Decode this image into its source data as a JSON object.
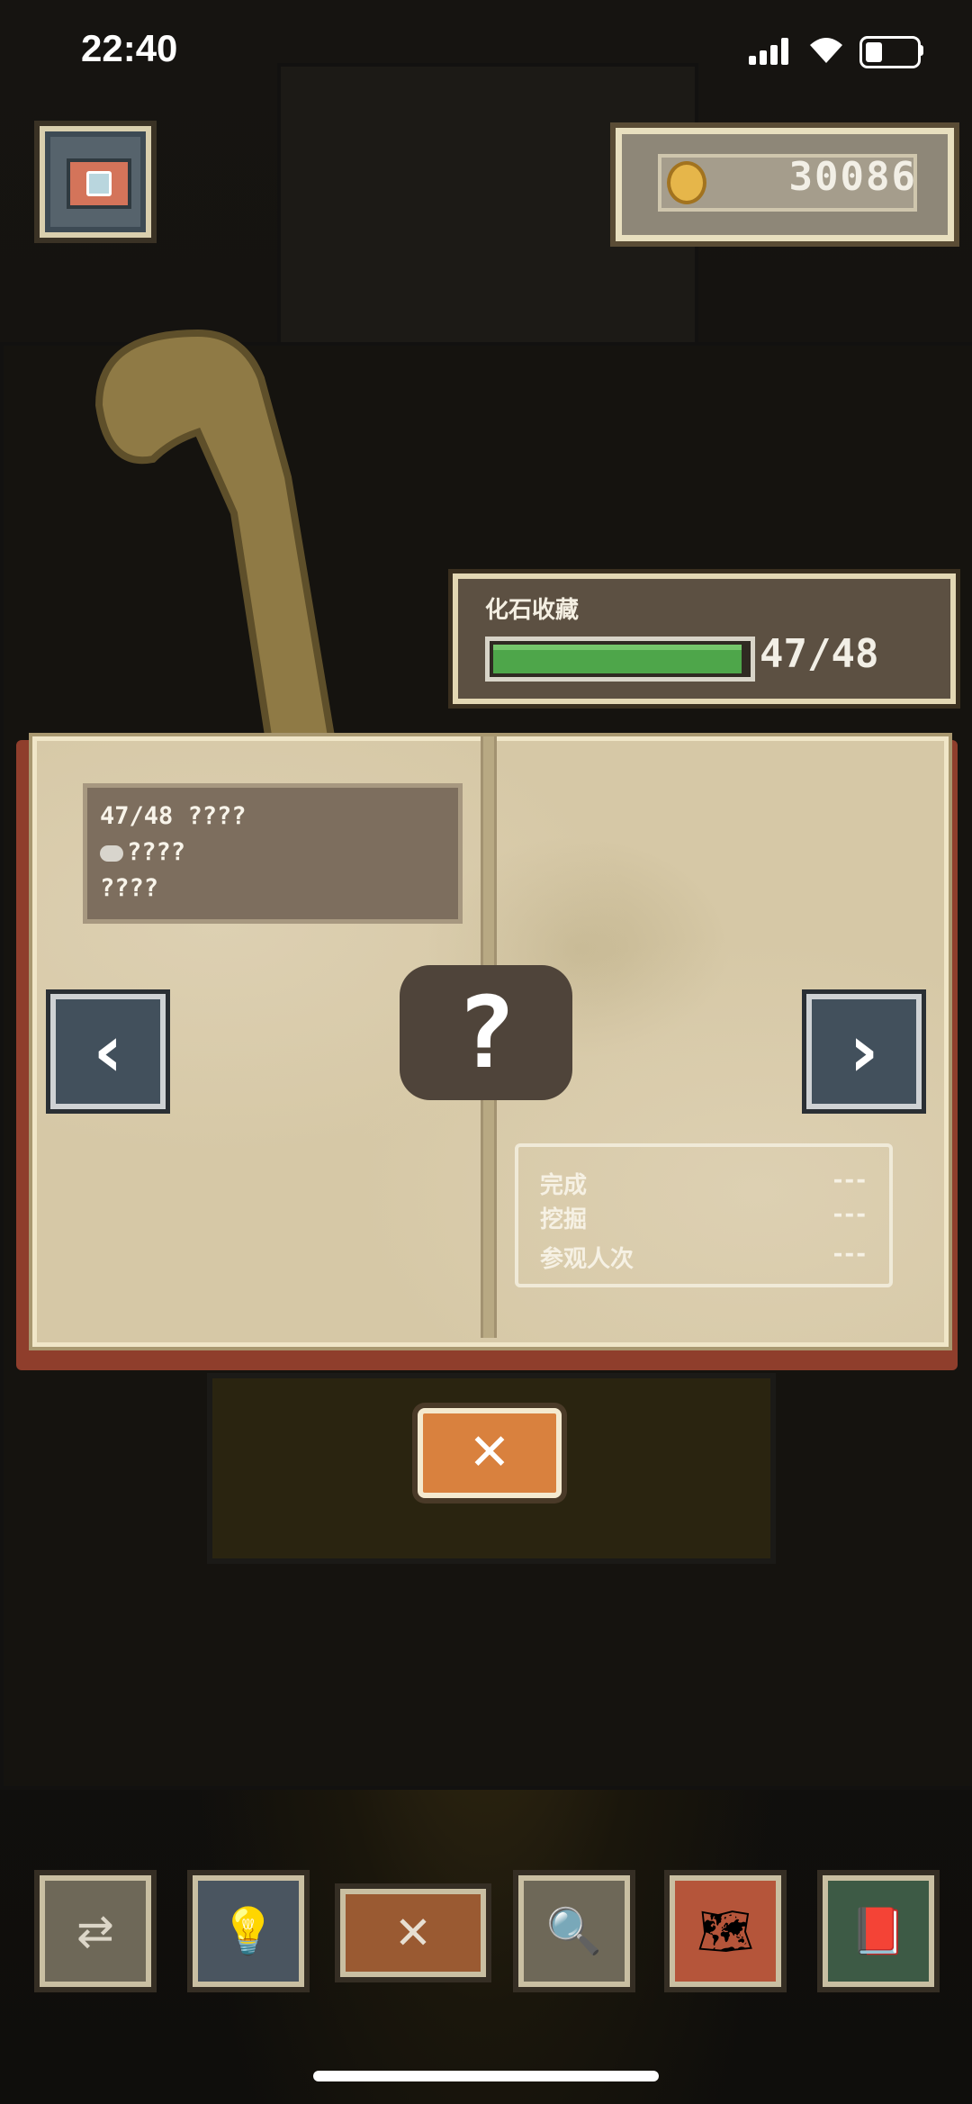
{
  "status_bar": {
    "time": "22:40"
  },
  "top": {
    "coin_amount": "30086",
    "camera_icon": "camera-icon",
    "coin_icon": "gold-coin-icon"
  },
  "collection": {
    "title": "化石收藏",
    "count": "47/48",
    "progress": 0.979,
    "bar_color": "#4ea64a"
  },
  "book": {
    "info_lines": [
      "47/48 ????",
      "????",
      "????"
    ],
    "mystery_symbol": "?",
    "stats": [
      {
        "label": "完成",
        "value": "---"
      },
      {
        "label": "挖掘",
        "value": "---"
      },
      {
        "label": "参观人次",
        "value": "---"
      }
    ],
    "prev_icon": "chevron-left-icon",
    "next_icon": "chevron-right-icon"
  },
  "close_button": {
    "label": "✕"
  },
  "dock": [
    {
      "name": "swap-icon",
      "glyph": "⇄"
    },
    {
      "name": "lightbulb-icon",
      "glyph": "💡"
    },
    {
      "name": "close-icon",
      "glyph": "✕"
    },
    {
      "name": "magnifier-icon",
      "glyph": "🔍"
    },
    {
      "name": "map-icon",
      "glyph": "🗺"
    },
    {
      "name": "book-icon",
      "glyph": "📕"
    }
  ]
}
